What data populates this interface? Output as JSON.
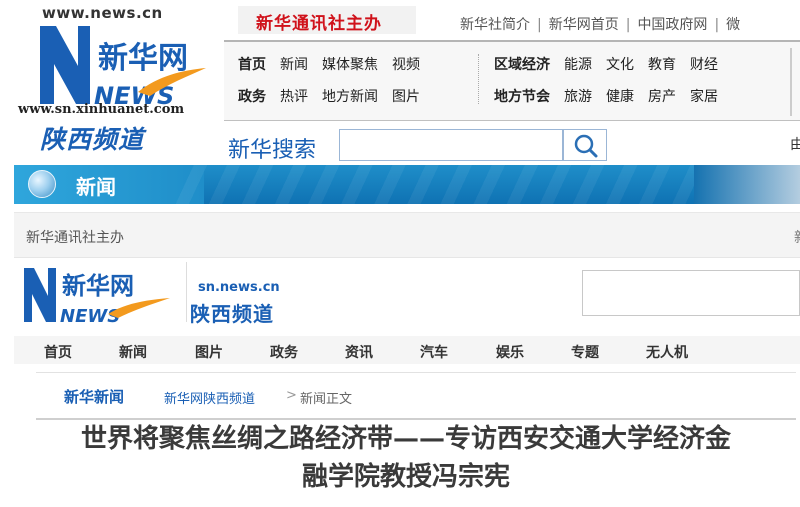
{
  "header": {
    "logo": {
      "url": "www.news.cn",
      "brand_cn": "新华网",
      "brand_en": "NEWS",
      "sub_url": "www.sn.xinhuanet.com",
      "channel": "陕西频道"
    },
    "brand_strip": "新华通讯社主办",
    "top_links": [
      "新华社简介",
      "新华网首页",
      "中国政府网",
      "微"
    ],
    "nav_rows": [
      [
        {
          "label": "首页",
          "bold": true
        },
        {
          "label": "新闻",
          "bold": false
        },
        {
          "label": "媒体聚焦",
          "bold": false
        },
        {
          "label": "视频",
          "bold": false
        }
      ],
      [
        {
          "label": "政务",
          "bold": true
        },
        {
          "label": "热评",
          "bold": false
        },
        {
          "label": "地方新闻",
          "bold": false
        },
        {
          "label": "图片",
          "bold": false
        }
      ]
    ],
    "nav_rows_right": [
      [
        {
          "label": "区域经济",
          "bold": true
        },
        {
          "label": "能源",
          "bold": false
        },
        {
          "label": "文化",
          "bold": false
        },
        {
          "label": "教育",
          "bold": false
        },
        {
          "label": "财经",
          "bold": false
        }
      ],
      [
        {
          "label": "地方节会",
          "bold": true
        },
        {
          "label": "旅游",
          "bold": false
        },
        {
          "label": "健康",
          "bold": false
        },
        {
          "label": "房产",
          "bold": false
        },
        {
          "label": "家居",
          "bold": false
        }
      ]
    ],
    "search_label": "新华搜索",
    "search_placeholder": "",
    "right_edge_char": "由"
  },
  "news_band": {
    "title": "新闻"
  },
  "gray_bar": {
    "text": "新华通讯社主办",
    "edge_text": "新"
  },
  "second_header": {
    "brand_cn": "新华网",
    "brand_en": "NEWS",
    "channel_url": "sn.news.cn",
    "channel_name": "陕西频道"
  },
  "channel_nav": [
    "首页",
    "新闻",
    "图片",
    "政务",
    "资讯",
    "汽车",
    "娱乐",
    "专题",
    "无人机"
  ],
  "breadcrumb": {
    "home": "新华新闻",
    "link": "新华网陕西频道",
    "separator": ">",
    "current": "新闻正文"
  },
  "article": {
    "title_line1": "世界将聚焦丝绸之路经济带——专访西安交通大学经济金",
    "title_line2": "融学院教授冯宗宪"
  },
  "colors": {
    "brand_red": "#d0121b",
    "brand_blue": "#1a5fb4",
    "band_blue": "#1f8ec9",
    "logo_orange": "#f39a1e"
  }
}
